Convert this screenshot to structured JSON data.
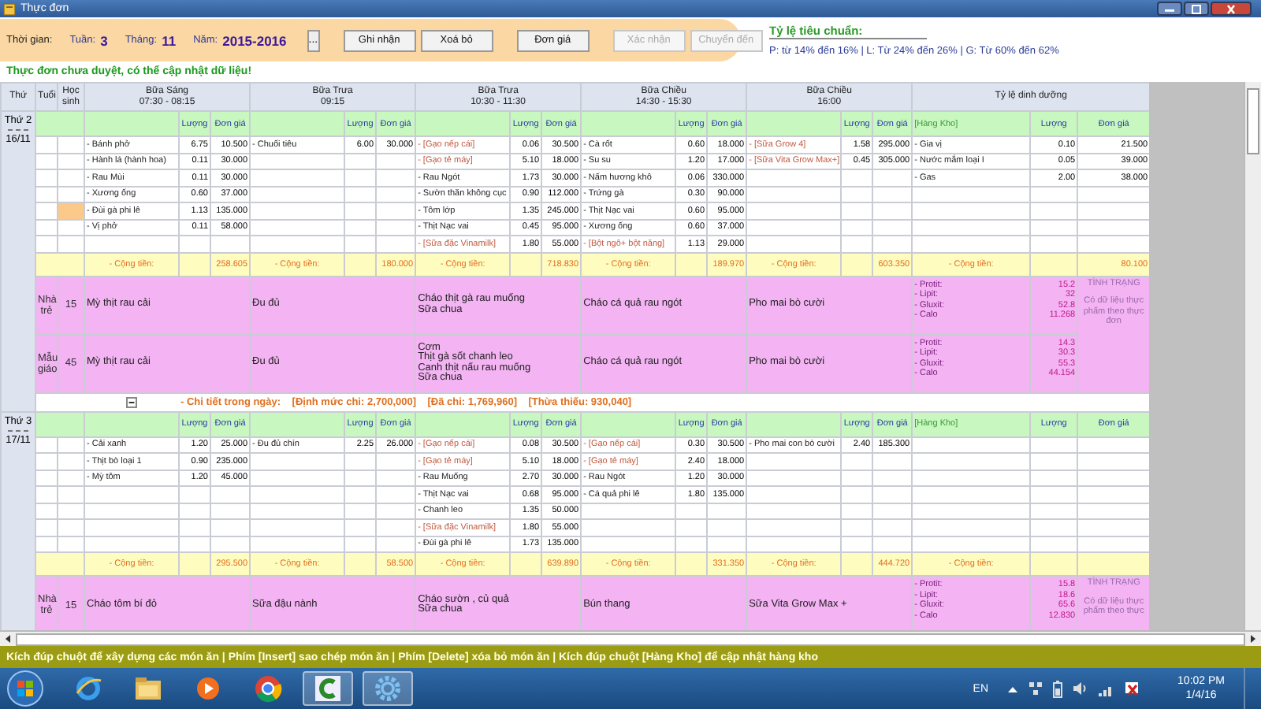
{
  "window": {
    "title": "Thực đơn"
  },
  "toolbar": {
    "time_label": "Thời gian:",
    "week_label": "Tuần:",
    "week": "3",
    "month_label": "Tháng:",
    "month": "11",
    "year_label": "Năm:",
    "year": "2015-2016",
    "browse_button": "...",
    "buttons": [
      {
        "label": "Ghi nhận",
        "disabled": false
      },
      {
        "label": "Xoá bỏ",
        "disabled": false
      },
      {
        "label": "Đơn giá",
        "disabled": false
      },
      {
        "label": "Xác nhận",
        "disabled": true
      },
      {
        "label": "Chuyển đến",
        "disabled": true
      }
    ]
  },
  "standard": {
    "title": "Tỷ lệ tiêu chuẩn:",
    "text": "P: từ 14% đến 16% | L: Từ 24% đến 26% | G: Từ 60% đến 62%"
  },
  "notice": "Thực đơn chưa duyệt, có thể cập nhật dữ liệu!",
  "table": {
    "columns": {
      "day": "Thứ",
      "age": "Tuổi",
      "students": "Học sinh",
      "meals": [
        {
          "name": "Bữa Sáng",
          "time": "07:30 - 08:15"
        },
        {
          "name": "Bữa Trưa",
          "time": "09:15"
        },
        {
          "name": "Bữa Trưa",
          "time": "10:30 - 11:30"
        },
        {
          "name": "Bữa Chiều",
          "time": "14:30 - 15:30"
        },
        {
          "name": "Bữa Chiều",
          "time": "16:00"
        }
      ],
      "nutrition": "Tỷ lệ dinh dưỡng"
    },
    "days": [
      {
        "day": "Thứ 2",
        "date": "16/11",
        "subheader": [
          {
            "qty": "Lượng",
            "price": "Đơn giá"
          },
          {
            "qty": "Lượng",
            "price": "Đơn giá"
          },
          {
            "qty": "Lượng",
            "price": "Đơn giá"
          },
          {
            "qty": "Lượng",
            "price": "Đơn giá"
          },
          {
            "qty": "Lượng",
            "price": "Đơn giá"
          },
          {
            "name": "[Hàng Kho]",
            "qty": "Lượng",
            "price": "Đơn giá"
          }
        ],
        "rows": [
          {
            "selected": false,
            "meal_1": {
              "name": "- Bánh phở",
              "qty": "6.75",
              "price": "10.500",
              "kind": "plain"
            },
            "meal_2": {
              "name": "- Chuối tiêu",
              "qty": "6.00",
              "price": "30.000",
              "kind": "plain"
            },
            "meal_3": {
              "name": "- [Gạo nếp cái]",
              "qty": "0.06",
              "price": "30.500",
              "kind": "stock"
            },
            "meal_4": {
              "name": "- Cà rốt",
              "qty": "0.60",
              "price": "18.000",
              "kind": "plain"
            },
            "meal_5": {
              "name": "- [Sữa Grow 4]",
              "qty": "1.58",
              "price": "295.000",
              "kind": "stock"
            },
            "nutrition": {
              "name": "- Gia vị",
              "qty": "0.10",
              "price": "21.500",
              "kind": "plain"
            }
          },
          {
            "selected": false,
            "meal_1": {
              "name": "- Hành lá (hành hoa)",
              "qty": "0.11",
              "price": "30.000",
              "kind": "plain"
            },
            "meal_3": {
              "name": "- [Gạo tẻ máy]",
              "qty": "5.10",
              "price": "18.000",
              "kind": "stock"
            },
            "meal_4": {
              "name": "- Su su",
              "qty": "1.20",
              "price": "17.000",
              "kind": "plain"
            },
            "meal_5": {
              "name": "- [Sữa Vita Grow Max+]",
              "qty": "0.45",
              "price": "305.000",
              "kind": "stock"
            },
            "nutrition": {
              "name": "- Nước mắm loại I",
              "qty": "0.05",
              "price": "39.000",
              "kind": "plain"
            }
          },
          {
            "selected": false,
            "meal_1": {
              "name": "- Rau Mùi",
              "qty": "0.11",
              "price": "30.000",
              "kind": "plain"
            },
            "meal_3": {
              "name": "- Rau Ngót",
              "qty": "1.73",
              "price": "30.000",
              "kind": "plain"
            },
            "meal_4": {
              "name": "- Nấm hương khô",
              "qty": "0.06",
              "price": "330.000",
              "kind": "plain"
            },
            "nutrition": {
              "name": "- Gas",
              "qty": "2.00",
              "price": "38.000",
              "kind": "plain"
            }
          },
          {
            "selected": false,
            "meal_1": {
              "name": "- Xương ống",
              "qty": "0.60",
              "price": "37.000",
              "kind": "plain"
            },
            "meal_3": {
              "name": "- Sườn thăn không cục",
              "qty": "0.90",
              "price": "112.000",
              "kind": "plain"
            },
            "meal_4": {
              "name": "- Trứng gà",
              "qty": "0.30",
              "price": "90.000",
              "kind": "plain"
            }
          },
          {
            "selected": true,
            "meal_1": {
              "name": "- Đùi gà phi lê",
              "qty": "1.13",
              "price": "135.000",
              "kind": "plain"
            },
            "meal_3": {
              "name": "- Tôm lớp",
              "qty": "1.35",
              "price": "245.000",
              "kind": "plain"
            },
            "meal_4": {
              "name": "- Thịt Nạc vai",
              "qty": "0.60",
              "price": "95.000",
              "kind": "plain"
            }
          },
          {
            "selected": false,
            "meal_1": {
              "name": "- Vị phở",
              "qty": "0.11",
              "price": "58.000",
              "kind": "plain"
            },
            "meal_3": {
              "name": "- Thịt Nạc vai",
              "qty": "0.45",
              "price": "95.000",
              "kind": "plain"
            },
            "meal_4": {
              "name": "- Xương ống",
              "qty": "0.60",
              "price": "37.000",
              "kind": "plain"
            }
          },
          {
            "selected": false,
            "meal_3": {
              "name": "- [Sữa đặc Vinamilk]",
              "qty": "1.80",
              "price": "55.000",
              "kind": "stock"
            },
            "meal_4": {
              "name": "- [Bột ngô+ bột năng]",
              "qty": "1.13",
              "price": "29.000",
              "kind": "stock"
            }
          }
        ],
        "totals": [
          {
            "label": "- Cộng tiền:",
            "value": "258.605"
          },
          {
            "label": "- Cộng tiền:",
            "value": "180.000"
          },
          {
            "label": "- Cộng tiền:",
            "value": "718.830"
          },
          {
            "label": "- Cộng tiền:",
            "value": "189.970"
          },
          {
            "label": "- Cộng tiền:",
            "value": "603.350"
          },
          {
            "label": "- Cộng tiền:",
            "value": "80.100"
          }
        ],
        "groups": [
          {
            "age": "Nhà trẻ",
            "students": "15",
            "dishes": [
              [
                "Mỳ thịt rau cải"
              ],
              [
                "Đu đủ"
              ],
              [
                "Cháo thịt gà rau muống",
                "Sữa chua"
              ],
              [
                "Cháo cá quả rau ngót"
              ],
              [
                "Pho mai bò cười"
              ]
            ],
            "nutrients": [
              {
                "name": "- Protit:",
                "value": "15.2"
              },
              {
                "name": "- Lipit:",
                "value": "32"
              },
              {
                "name": "- Gluxit:",
                "value": "52.8"
              },
              {
                "name": "- Calo",
                "value": "11.268"
              }
            ]
          },
          {
            "age": "Mẫu giáo",
            "students": "45",
            "dishes": [
              [
                "Mỳ thịt rau cải"
              ],
              [
                "Đu đủ"
              ],
              [
                "Cơm",
                "Thịt gà sốt chanh leo",
                "Canh thịt nấu rau muống",
                "Sữa chua"
              ],
              [
                "Cháo cá quả rau ngót"
              ],
              [
                "Pho mai bò cười"
              ]
            ],
            "nutrients": [
              {
                "name": "- Protit:",
                "value": "14.3"
              },
              {
                "name": "- Lipit:",
                "value": "30.3"
              },
              {
                "name": "- Gluxit:",
                "value": "55.3"
              },
              {
                "name": "- Calo",
                "value": "44.154"
              }
            ]
          }
        ],
        "status": {
          "title": "TÌNH TRẠNG",
          "text": "Có dữ liệu thực phẩm theo thực đơn"
        },
        "summary": {
          "expanded": true,
          "label": "- Chi tiết trong ngày:",
          "items": [
            "[Định mức chi: 2,700,000]",
            "[Đã chi: 1,769,960]",
            "[Thừa thiếu: 930,040]"
          ]
        }
      },
      {
        "day": "Thứ 3",
        "date": "17/11",
        "subheader": [
          {
            "qty": "Lượng",
            "price": "Đơn giá"
          },
          {
            "qty": "Lượng",
            "price": "Đơn giá"
          },
          {
            "qty": "Lượng",
            "price": "Đơn giá"
          },
          {
            "qty": "Lượng",
            "price": "Đơn giá"
          },
          {
            "qty": "Lượng",
            "price": "Đơn giá"
          },
          {
            "name": "[Hàng Kho]",
            "qty": "Lượng",
            "price": "Đơn giá"
          }
        ],
        "rows": [
          {
            "selected": false,
            "meal_1": {
              "name": "- Cải xanh",
              "qty": "1.20",
              "price": "25.000",
              "kind": "plain"
            },
            "meal_2": {
              "name": "- Đu đủ chín",
              "qty": "2.25",
              "price": "26.000",
              "kind": "plain"
            },
            "meal_3": {
              "name": "- [Gạo nếp cái]",
              "qty": "0.08",
              "price": "30.500",
              "kind": "stock"
            },
            "meal_4": {
              "name": "- [Gạo nếp cái]",
              "qty": "0.30",
              "price": "30.500",
              "kind": "stock"
            },
            "meal_5": {
              "name": "- Pho mai con bò cười",
              "qty": "2.40",
              "price": "185.300",
              "kind": "plain"
            }
          },
          {
            "selected": false,
            "meal_1": {
              "name": "- Thịt bò loại 1",
              "qty": "0.90",
              "price": "235.000",
              "kind": "plain"
            },
            "meal_3": {
              "name": "- [Gạo tẻ máy]",
              "qty": "5.10",
              "price": "18.000",
              "kind": "stock"
            },
            "meal_4": {
              "name": "- [Gạo tẻ máy]",
              "qty": "2.40",
              "price": "18.000",
              "kind": "stock"
            }
          },
          {
            "selected": false,
            "meal_1": {
              "name": "- Mỳ tôm",
              "qty": "1.20",
              "price": "45.000",
              "kind": "plain"
            },
            "meal_3": {
              "name": "- Rau Muống",
              "qty": "2.70",
              "price": "30.000",
              "kind": "plain"
            },
            "meal_4": {
              "name": "- Rau Ngót",
              "qty": "1.20",
              "price": "30.000",
              "kind": "plain"
            }
          },
          {
            "selected": false,
            "meal_3": {
              "name": "- Thịt Nạc vai",
              "qty": "0.68",
              "price": "95.000",
              "kind": "plain"
            },
            "meal_4": {
              "name": "- Cá quả phi lê",
              "qty": "1.80",
              "price": "135.000",
              "kind": "plain"
            }
          },
          {
            "selected": false,
            "meal_3": {
              "name": "- Chanh leo",
              "qty": "1.35",
              "price": "50.000",
              "kind": "plain"
            }
          },
          {
            "selected": false,
            "meal_3": {
              "name": "- [Sữa đặc Vinamilk]",
              "qty": "1.80",
              "price": "55.000",
              "kind": "stock"
            }
          },
          {
            "selected": false,
            "meal_3": {
              "name": "- Đùi gà phi lê",
              "qty": "1.73",
              "price": "135.000",
              "kind": "plain"
            }
          }
        ],
        "totals": [
          {
            "label": "- Cộng tiền:",
            "value": "295.500"
          },
          {
            "label": "- Cộng tiền:",
            "value": "58.500"
          },
          {
            "label": "- Cộng tiền:",
            "value": "639.890"
          },
          {
            "label": "- Cộng tiền:",
            "value": "331.350"
          },
          {
            "label": "- Cộng tiền:",
            "value": "444.720"
          },
          {
            "label": "- Cộng tiền:"
          }
        ],
        "groups": [
          {
            "age": "Nhà trẻ",
            "students": "15",
            "dishes": [
              [
                "Cháo tôm bí đỏ"
              ],
              [
                "Sữa đậu nành"
              ],
              [
                "Cháo sườn , củ quả",
                "Sữa chua"
              ],
              [
                "Bún thang"
              ],
              [
                "Sữa Vita Grow Max +"
              ]
            ],
            "nutrients": [
              {
                "name": "- Protit:",
                "value": "15.8"
              },
              {
                "name": "- Lipit:",
                "value": "18.6"
              },
              {
                "name": "- Gluxit:",
                "value": "65.6"
              },
              {
                "name": "- Calo",
                "value": "12.830"
              }
            ]
          }
        ],
        "status": {
          "title": "TÌNH TRẠNG",
          "text": "Có dữ liệu thực phẩm theo thực"
        }
      }
    ]
  },
  "status_bar": "Kích đúp chuột để xây dựng các món ăn  |  Phím [Insert] sao chép món ăn  |  Phím [Delete] xóa bỏ món ăn  |  Kích đúp chuột [Hàng Kho] để cập nhật hàng kho",
  "taskbar": {
    "language": "EN",
    "time": "10:02 PM",
    "date": "1/4/16"
  }
}
